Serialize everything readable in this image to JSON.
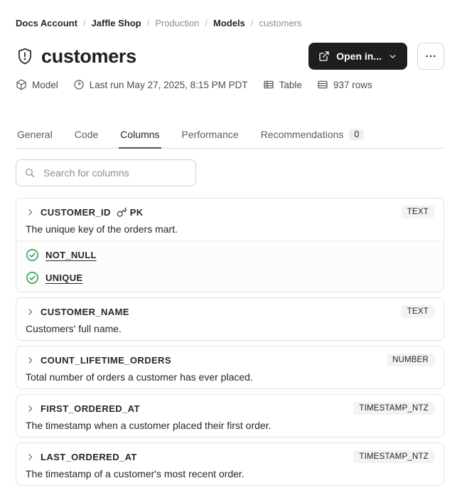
{
  "colors": {
    "accent_dark": "#1e1e1e",
    "success_green": "#2f9e4f",
    "badge_bg": "#f3f3f3",
    "border": "#e3e3e3",
    "active_tab_underline": "#56524d"
  },
  "breadcrumb": {
    "separator": "/",
    "items": [
      {
        "label": "Docs Account",
        "emphasis": true
      },
      {
        "label": "Jaffle Shop",
        "emphasis": true
      },
      {
        "label": "Production",
        "emphasis": false
      },
      {
        "label": "Models",
        "emphasis": true
      },
      {
        "label": "customers",
        "emphasis": false
      }
    ]
  },
  "header": {
    "title": "customers",
    "open_in_button": "Open in..."
  },
  "meta": {
    "items": [
      {
        "icon": "cube-icon",
        "label": "Model"
      },
      {
        "icon": "clock-icon",
        "label": "Last run May 27, 2025, 8:15 PM PDT"
      },
      {
        "icon": "table-icon",
        "label": "Table"
      },
      {
        "icon": "rows-icon",
        "label": "937 rows"
      }
    ]
  },
  "tabs": [
    {
      "label": "General",
      "active": false
    },
    {
      "label": "Code",
      "active": false
    },
    {
      "label": "Columns",
      "active": true
    },
    {
      "label": "Performance",
      "active": false
    },
    {
      "label": "Recommendations",
      "active": false,
      "badge": "0"
    }
  ],
  "search": {
    "placeholder": "Search for columns"
  },
  "columns": [
    {
      "name": "CUSTOMER_ID",
      "pk_label": "PK",
      "type": "TEXT",
      "description": "The unique key of the orders mart.",
      "tests": [
        "NOT_NULL",
        "UNIQUE"
      ]
    },
    {
      "name": "CUSTOMER_NAME",
      "type": "TEXT",
      "description": "Customers' full name."
    },
    {
      "name": "COUNT_LIFETIME_ORDERS",
      "type": "NUMBER",
      "description": "Total number of orders a customer has ever placed."
    },
    {
      "name": "FIRST_ORDERED_AT",
      "type": "TIMESTAMP_NTZ",
      "description": "The timestamp when a customer placed their first order."
    },
    {
      "name": "LAST_ORDERED_AT",
      "type": "TIMESTAMP_NTZ",
      "description": "The timestamp of a customer's most recent order."
    }
  ]
}
